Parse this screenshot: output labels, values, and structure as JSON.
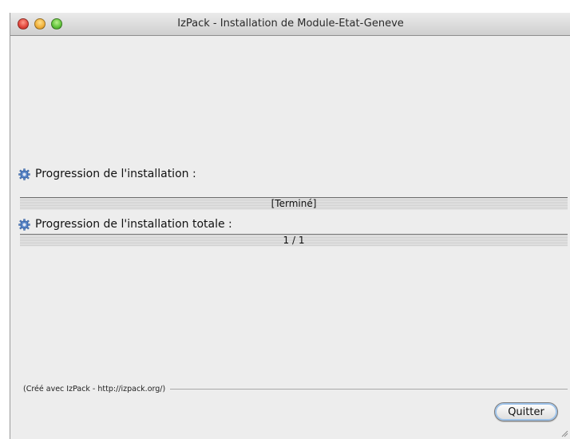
{
  "window": {
    "title": "IzPack - Installation de Module-Etat-Geneve"
  },
  "install_progress": {
    "label": "Progression de l'installation :",
    "text": "[Terminé]",
    "fraction": 1.0,
    "icon": "gear-icon"
  },
  "overall_progress": {
    "label": "Progression de l'installation totale :",
    "text": "1 / 1",
    "fraction": 1.0,
    "icon": "gear-icon"
  },
  "footer": {
    "credit": "(Créé avec IzPack - http://izpack.org/)",
    "quit_label": "Quitter"
  },
  "colors": {
    "window_bg": "#ededed",
    "button_focus": "#9ec3ea"
  }
}
